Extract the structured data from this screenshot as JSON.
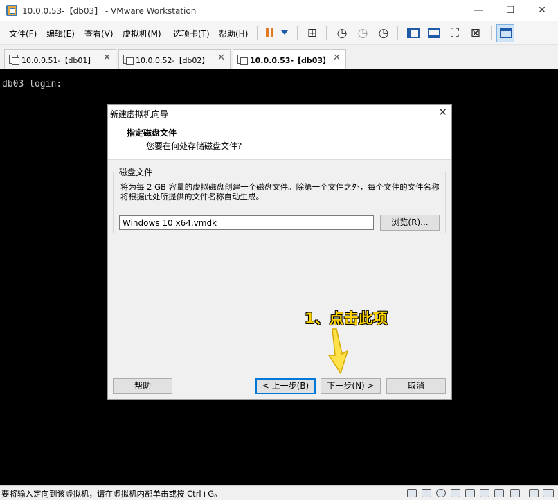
{
  "window": {
    "title": "10.0.0.53-【db03】 - VMware Workstation",
    "minimize": "—",
    "maximize": "☐",
    "close": "✕"
  },
  "menu": {
    "items": [
      "文件(F)",
      "编辑(E)",
      "查看(V)",
      "虚拟机(M)",
      "选项卡(T)",
      "帮助(H)"
    ]
  },
  "toolbar": {
    "icons": [
      "pause-icon",
      "dropdown-arrow-icon",
      "network-icon",
      "snapshot-icon",
      "revert-snapshot-icon",
      "snapshot-manager-icon",
      "console-view-icon",
      "unity-icon",
      "fullscreen-icon",
      "stretch-icon",
      "library-icon"
    ]
  },
  "tabs": [
    {
      "label": "10.0.0.51-【db01】",
      "close": "✕"
    },
    {
      "label": "10.0.0.52-【db02】",
      "close": "✕"
    },
    {
      "label": "10.0.0.53-【db03】",
      "close": "✕"
    }
  ],
  "console": {
    "text": "db03 login:"
  },
  "dialog": {
    "title": "新建虚拟机向导",
    "close": "✕",
    "heading": "指定磁盘文件",
    "subheading": "您要在何处存储磁盘文件?",
    "group_label": "磁盘文件",
    "description": "将为每 2 GB 容量的虚拟磁盘创建一个磁盘文件。除第一个文件之外，每个文件的文件名称将根据此处所提供的文件名称自动生成。",
    "file_value": "Windows 10 x64.vmdk",
    "browse_label": "浏览(R)...",
    "help_label": "帮助",
    "back_label": "< 上一步(B)",
    "next_label": "下一步(N) >",
    "cancel_label": "取消"
  },
  "annotation": {
    "text": "1、点击此项",
    "color": "#ffd400"
  },
  "statusbar": {
    "text": "要将输入定向到该虚拟机，请在虚拟机内部单击或按 Ctrl+G。"
  },
  "colors": {
    "accent": "#0078d7",
    "pause": "#e07b22",
    "console_bg": "#000000"
  }
}
